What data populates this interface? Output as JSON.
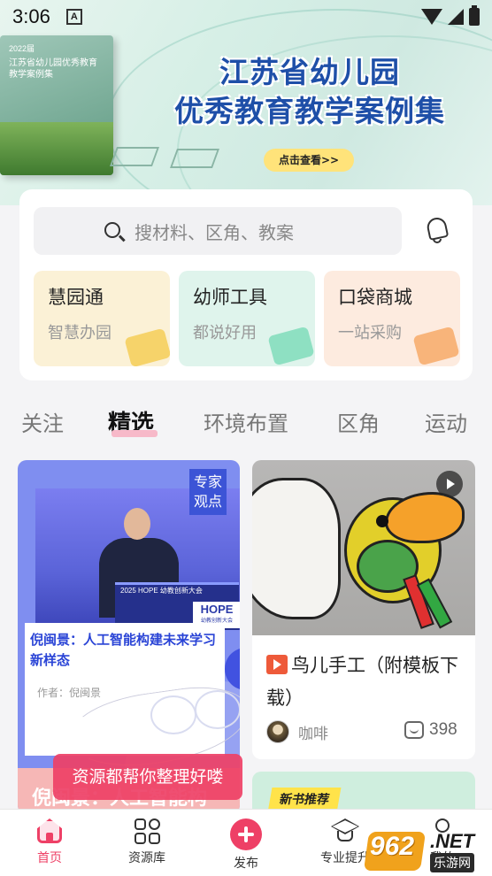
{
  "status_bar": {
    "time": "3:06",
    "notification_glyph": "A",
    "icons": [
      "wifi-icon",
      "signal-icon",
      "battery-icon"
    ]
  },
  "banner": {
    "book_year": "2022届",
    "book_title": "江苏省幼儿园优秀教育教学案例集",
    "title_line1": "江苏省幼儿园",
    "title_line2": "优秀教育教学案例集",
    "cta": "点击查看>>"
  },
  "search": {
    "placeholder": "搜材料、区角、教案",
    "icon": "search-icon"
  },
  "notification": {
    "icon": "bell-icon"
  },
  "quick_tiles": [
    {
      "title": "慧园通",
      "subtitle": "智慧办园",
      "color": "#fbf1d6"
    },
    {
      "title": "幼师工具",
      "subtitle": "都说好用",
      "color": "#dff4ec"
    },
    {
      "title": "口袋商城",
      "subtitle": "一站采购",
      "color": "#fdebdf"
    }
  ],
  "category_tabs": [
    "关注",
    "精选",
    "环境布置",
    "区角",
    "运动"
  ],
  "active_tab": "精选",
  "feed": {
    "left_card": {
      "badge": "专家观点",
      "podium_text": "2025 HOPE 幼教创新大会",
      "hope_logo": "HOPE",
      "hope_sub": "幼教创新大会",
      "title": "倪闽景：人工智能构建未来学习新样态",
      "author": "作者：倪闽景",
      "bottom_text": "倪闽景：人工智能构"
    },
    "toast": "资源都帮你整理好喽",
    "right_card": {
      "title": "鸟儿手工（附模板下载）",
      "author": "咖啡",
      "comments": "398",
      "has_video": true
    },
    "right_card_2": {
      "badge": "新书推荐"
    }
  },
  "bottom_nav": [
    {
      "label": "首页",
      "icon": "home-icon",
      "active": true
    },
    {
      "label": "资源库",
      "icon": "grid-icon",
      "active": false
    },
    {
      "label": "发布",
      "icon": "plus-icon",
      "active": false
    },
    {
      "label": "专业提升",
      "icon": "graduation-cap-icon",
      "active": false
    },
    {
      "label": "我的",
      "icon": "person-icon",
      "active": false
    }
  ],
  "watermark": {
    "number": "962",
    "domain": ".NET",
    "text": "乐游网"
  },
  "colors": {
    "accent": "#ee4066",
    "link_blue": "#2a44d6",
    "banner_title": "#1e4fa8"
  }
}
